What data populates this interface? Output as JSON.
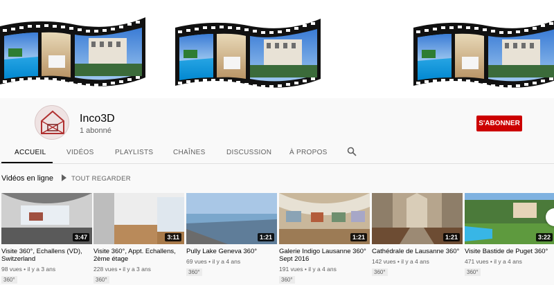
{
  "channel": {
    "name": "Inco3D",
    "subscribers": "1 abonné",
    "subscribe_label": "S'ABONNER"
  },
  "tabs": [
    {
      "label": "ACCUEIL",
      "active": true
    },
    {
      "label": "VIDÉOS",
      "active": false
    },
    {
      "label": "PLAYLISTS",
      "active": false
    },
    {
      "label": "CHAÎNES",
      "active": false
    },
    {
      "label": "DISCUSSION",
      "active": false
    },
    {
      "label": "À PROPOS",
      "active": false
    }
  ],
  "section": {
    "title": "Vidéos en ligne",
    "play_all": "TOUT REGARDER"
  },
  "videos": [
    {
      "title": "Visite 360°, Echallens (VD), Switzerland",
      "duration": "3:47",
      "views": "98 vues",
      "age": "il y a 3 ans",
      "badge": "360°"
    },
    {
      "title": "Visite 360°, Appt. Echallens, 2ème étage",
      "duration": "3:11",
      "views": "228 vues",
      "age": "il y a 3 ans",
      "badge": "360°"
    },
    {
      "title": "Pully Lake Geneva 360°",
      "duration": "1:21",
      "views": "69 vues",
      "age": "il y a 4 ans",
      "badge": "360°"
    },
    {
      "title": "Galerie Indigo Lausanne 360° Sept 2016",
      "duration": "1:21",
      "views": "191 vues",
      "age": "il y a 4 ans",
      "badge": "360°"
    },
    {
      "title": "Cathédrale de Lausanne 360°",
      "duration": "1:21",
      "views": "142 vues",
      "age": "il y a 4 ans",
      "badge": "360°"
    },
    {
      "title": "Visite Bastide de Puget 360°",
      "duration": "3:22",
      "views": "471 vues",
      "age": "il y a 4 ans",
      "badge": "360°"
    }
  ],
  "colors": {
    "subscribe_red": "#cc0000",
    "text_primary": "#030303",
    "text_secondary": "#606060"
  }
}
